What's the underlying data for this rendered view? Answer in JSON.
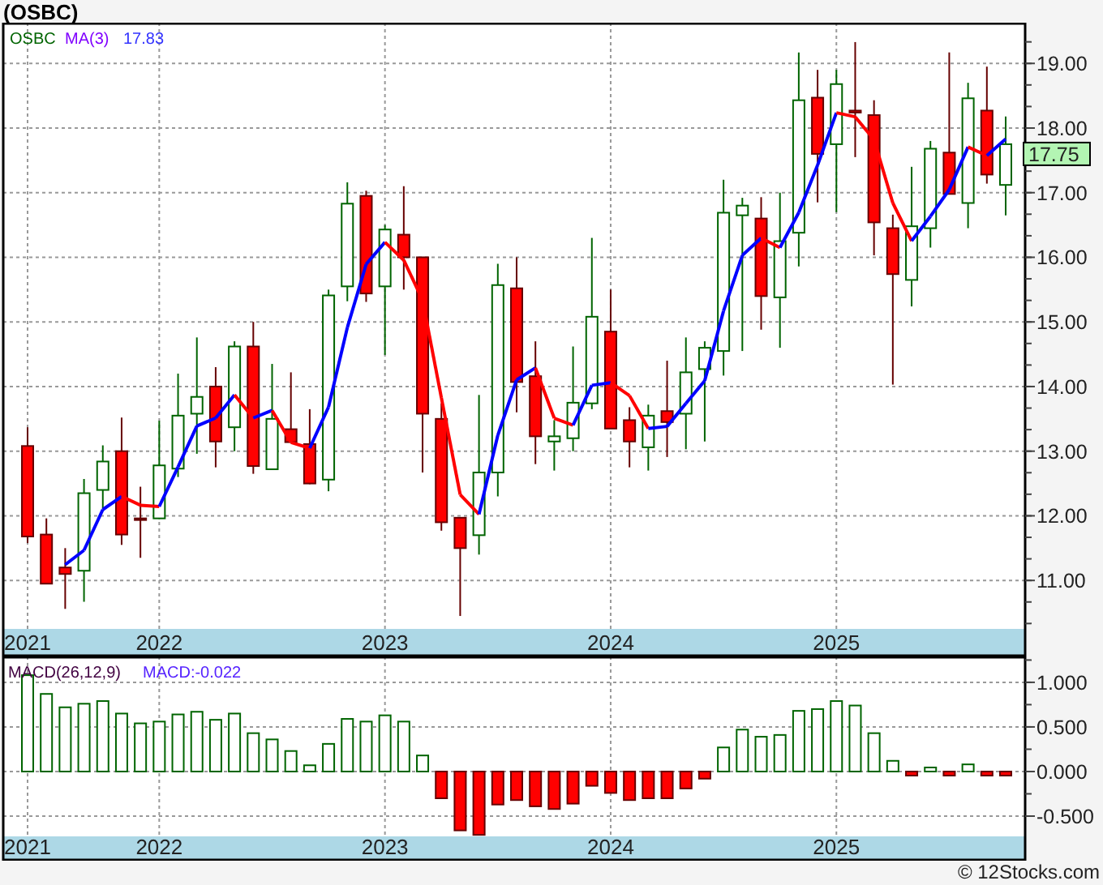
{
  "title": "(OSBC)",
  "price_panel": {
    "legend": [
      {
        "kind": "symbol",
        "text": "OSBC"
      },
      {
        "kind": "indicator",
        "text": "MA(3)"
      },
      {
        "kind": "value",
        "text": "17.83"
      }
    ],
    "last_price": "17.75",
    "chart_data": {
      "type": "candlestick",
      "grid": true,
      "ylim": [
        10.25,
        19.63
      ],
      "categories": [
        "2021",
        null,
        null,
        null,
        null,
        null,
        null,
        "2022",
        null,
        null,
        null,
        null,
        null,
        null,
        null,
        null,
        null,
        null,
        null,
        "2023",
        null,
        null,
        null,
        null,
        null,
        null,
        null,
        null,
        null,
        null,
        null,
        "2024",
        null,
        null,
        null,
        null,
        null,
        null,
        null,
        null,
        null,
        null,
        null,
        "2025",
        null,
        null,
        null,
        null,
        null,
        null,
        null,
        null,
        null
      ],
      "yticks": [
        {
          "value": 11,
          "label": "11.00"
        },
        {
          "value": 12,
          "label": "12.00"
        },
        {
          "value": 13,
          "label": "13.00"
        },
        {
          "value": 14,
          "label": "14.00"
        },
        {
          "value": 15,
          "label": "15.00"
        },
        {
          "value": 16,
          "label": "16.00"
        },
        {
          "value": 17,
          "label": "17.00"
        },
        {
          "value": 18,
          "label": "18.00"
        },
        {
          "value": 19,
          "label": "19.00"
        }
      ],
      "ohlc": [
        [
          13.08,
          13.37,
          11.58,
          11.68
        ],
        [
          11.71,
          11.96,
          10.95,
          10.95
        ],
        [
          11.2,
          11.5,
          10.56,
          11.1
        ],
        [
          11.15,
          12.57,
          10.67,
          12.35
        ],
        [
          12.4,
          13.09,
          12.1,
          12.84
        ],
        [
          13.0,
          13.52,
          11.55,
          11.71
        ],
        [
          11.96,
          12.45,
          11.35,
          11.94
        ],
        [
          11.96,
          13.47,
          11.95,
          12.78
        ],
        [
          12.73,
          14.2,
          12.6,
          13.55
        ],
        [
          13.58,
          14.76,
          12.96,
          13.84
        ],
        [
          14.0,
          14.3,
          12.75,
          13.15
        ],
        [
          13.37,
          14.7,
          13.0,
          14.62
        ],
        [
          14.62,
          15.0,
          12.65,
          12.77
        ],
        [
          12.72,
          14.35,
          12.72,
          13.5
        ],
        [
          13.34,
          14.22,
          13.14,
          13.14
        ],
        [
          13.11,
          13.65,
          12.49,
          12.5
        ],
        [
          12.56,
          15.5,
          12.38,
          15.41
        ],
        [
          15.55,
          17.16,
          15.32,
          16.83
        ],
        [
          16.95,
          17.03,
          15.31,
          15.44
        ],
        [
          15.55,
          16.5,
          14.49,
          16.43
        ],
        [
          16.35,
          17.1,
          15.5,
          16.0
        ],
        [
          16.0,
          16.0,
          12.67,
          13.58
        ],
        [
          13.5,
          13.74,
          11.77,
          11.9
        ],
        [
          11.97,
          11.97,
          10.45,
          11.5
        ],
        [
          11.7,
          13.87,
          11.4,
          12.67
        ],
        [
          12.67,
          15.9,
          12.3,
          15.57
        ],
        [
          15.52,
          16.0,
          13.6,
          14.07
        ],
        [
          14.16,
          14.7,
          12.8,
          13.23
        ],
        [
          13.15,
          13.48,
          12.7,
          13.23
        ],
        [
          13.2,
          14.62,
          13.0,
          13.75
        ],
        [
          13.74,
          16.3,
          13.65,
          15.08
        ],
        [
          14.85,
          15.5,
          13.35,
          13.35
        ],
        [
          13.48,
          13.68,
          12.75,
          13.15
        ],
        [
          13.06,
          13.72,
          12.7,
          13.55
        ],
        [
          13.62,
          14.4,
          12.91,
          13.45
        ],
        [
          13.58,
          14.76,
          13.03,
          14.22
        ],
        [
          14.27,
          14.7,
          13.15,
          14.6
        ],
        [
          14.55,
          17.2,
          14.17,
          16.69
        ],
        [
          16.65,
          16.92,
          14.55,
          16.8
        ],
        [
          16.6,
          16.93,
          14.88,
          15.4
        ],
        [
          15.38,
          17.0,
          14.6,
          16.25
        ],
        [
          16.38,
          19.17,
          15.86,
          18.43
        ],
        [
          18.47,
          18.9,
          16.85,
          17.6
        ],
        [
          17.75,
          18.9,
          16.7,
          18.68
        ],
        [
          18.27,
          19.33,
          17.55,
          18.24
        ],
        [
          18.2,
          18.43,
          16.03,
          16.54
        ],
        [
          16.45,
          16.66,
          14.03,
          15.74
        ],
        [
          15.65,
          17.4,
          15.24,
          16.48
        ],
        [
          16.45,
          17.8,
          16.15,
          17.68
        ],
        [
          17.62,
          19.17,
          16.98,
          16.98
        ],
        [
          16.84,
          18.7,
          16.45,
          18.46
        ],
        [
          18.27,
          18.95,
          17.14,
          17.28
        ],
        [
          17.12,
          18.18,
          16.65,
          17.75
        ]
      ]
    }
  },
  "macd_panel": {
    "legend": [
      {
        "kind": "indicator",
        "text": "MACD(26,12,9)"
      },
      {
        "kind": "value",
        "text": "MACD:-0.022"
      }
    ],
    "chart_data": {
      "type": "bar",
      "grid": true,
      "ylim": [
        -0.727,
        1.29
      ],
      "categories": [
        "2021",
        null,
        null,
        null,
        null,
        null,
        null,
        "2022",
        null,
        null,
        null,
        null,
        null,
        null,
        null,
        null,
        null,
        null,
        null,
        "2023",
        null,
        null,
        null,
        null,
        null,
        null,
        null,
        null,
        null,
        null,
        null,
        "2024",
        null,
        null,
        null,
        null,
        null,
        null,
        null,
        null,
        null,
        null,
        null,
        "2025",
        null,
        null,
        null,
        null,
        null,
        null,
        null,
        null,
        null
      ],
      "yticks": [
        {
          "value": -0.5,
          "label": "-0.500"
        },
        {
          "value": 0,
          "label": "0.000"
        },
        {
          "value": 0.5,
          "label": "0.500"
        },
        {
          "value": 1,
          "label": "1.000"
        }
      ],
      "values": [
        1.08,
        0.87,
        0.72,
        0.76,
        0.79,
        0.65,
        0.54,
        0.56,
        0.64,
        0.67,
        0.58,
        0.65,
        0.43,
        0.36,
        0.23,
        0.07,
        0.31,
        0.59,
        0.56,
        0.63,
        0.56,
        0.18,
        -0.3,
        -0.66,
        -0.71,
        -0.37,
        -0.32,
        -0.39,
        -0.42,
        -0.36,
        -0.16,
        -0.24,
        -0.32,
        -0.3,
        -0.3,
        -0.19,
        -0.08,
        0.27,
        0.47,
        0.39,
        0.41,
        0.68,
        0.7,
        0.79,
        0.74,
        0.43,
        0.12,
        -0.02,
        0.03,
        -0.04,
        0.08,
        -0.01,
        -0.02
      ]
    }
  },
  "credit": "© 12Stocks.com"
}
